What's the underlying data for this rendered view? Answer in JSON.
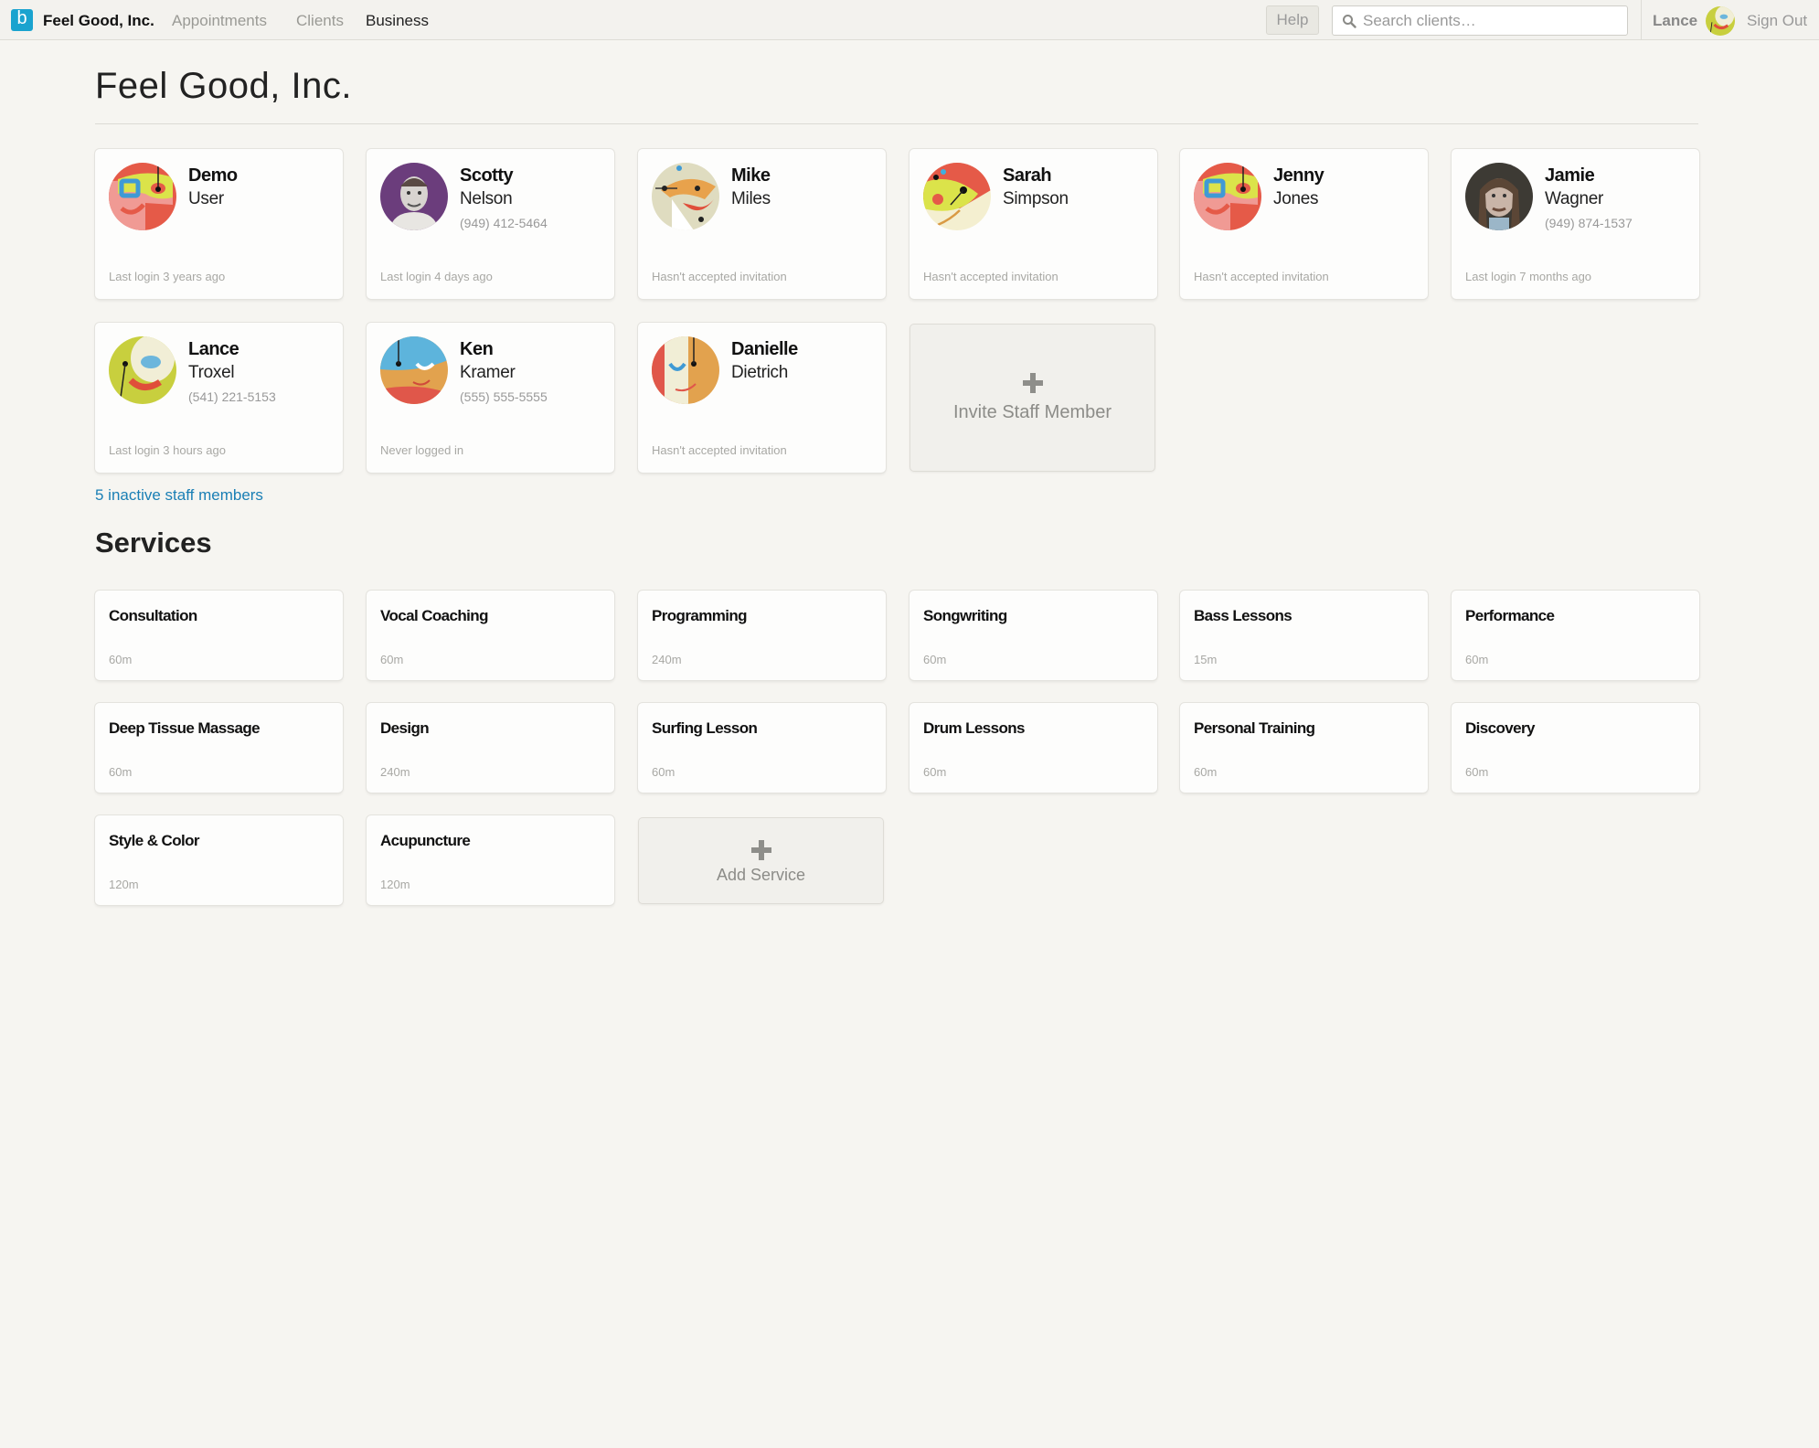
{
  "nav": {
    "logo_letter": "b",
    "brand": "Feel Good, Inc.",
    "links": [
      {
        "label": "Appointments",
        "active": false
      },
      {
        "label": "Clients",
        "active": false
      },
      {
        "label": "Business",
        "active": true
      }
    ],
    "help_label": "Help",
    "search_placeholder": "Search clients…",
    "search_icon": "search-icon",
    "user_name": "Lance",
    "signout_label": "Sign Out"
  },
  "page": {
    "title": "Feel Good, Inc."
  },
  "staff": [
    {
      "first": "Demo",
      "last": "User",
      "phone": "",
      "status": "Last login 3 years ago",
      "avatar": "red-face"
    },
    {
      "first": "Scotty",
      "last": "Nelson",
      "phone": "(949) 412-5464",
      "status": "Last login 4 days ago",
      "avatar": "photo-purple"
    },
    {
      "first": "Mike",
      "last": "Miles",
      "phone": "",
      "status": "Hasn't accepted invitation",
      "avatar": "beige-face"
    },
    {
      "first": "Sarah",
      "last": "Simpson",
      "phone": "",
      "status": "Hasn't accepted invitation",
      "avatar": "red-yellow-face"
    },
    {
      "first": "Jenny",
      "last": "Jones",
      "phone": "",
      "status": "Hasn't accepted invitation",
      "avatar": "red-face"
    },
    {
      "first": "Jamie",
      "last": "Wagner",
      "phone": "(949) 874-1537",
      "status": "Last login 7 months ago",
      "avatar": "photo-dark"
    },
    {
      "first": "Lance",
      "last": "Troxel",
      "phone": "(541) 221-5153",
      "status": "Last login 3 hours ago",
      "avatar": "green-face"
    },
    {
      "first": "Ken",
      "last": "Kramer",
      "phone": "(555) 555-5555",
      "status": "Never logged in",
      "avatar": "blue-orange-face"
    },
    {
      "first": "Danielle",
      "last": "Dietrich",
      "phone": "",
      "status": "Hasn't accepted invitation",
      "avatar": "red-cream-face"
    }
  ],
  "invite_label": "Invite Staff Member",
  "inactive_link": "5 inactive staff members",
  "services_title": "Services",
  "services": [
    {
      "name": "Consultation",
      "duration": "60m"
    },
    {
      "name": "Vocal Coaching",
      "duration": "60m"
    },
    {
      "name": "Programming",
      "duration": "240m"
    },
    {
      "name": "Songwriting",
      "duration": "60m"
    },
    {
      "name": "Bass Lessons",
      "duration": "15m"
    },
    {
      "name": "Performance",
      "duration": "60m"
    },
    {
      "name": "Deep Tissue Massage",
      "duration": "60m"
    },
    {
      "name": "Design",
      "duration": "240m"
    },
    {
      "name": "Surfing Lesson",
      "duration": "60m"
    },
    {
      "name": "Drum Lessons",
      "duration": "60m"
    },
    {
      "name": "Personal Training",
      "duration": "60m"
    },
    {
      "name": "Discovery",
      "duration": "60m"
    },
    {
      "name": "Style & Color",
      "duration": "120m"
    },
    {
      "name": "Acupuncture",
      "duration": "120m"
    }
  ],
  "add_service_label": "Add Service",
  "colors": {
    "brand": "#1aa3cf",
    "link": "#1a7fb5",
    "background": "#f6f5f1"
  }
}
